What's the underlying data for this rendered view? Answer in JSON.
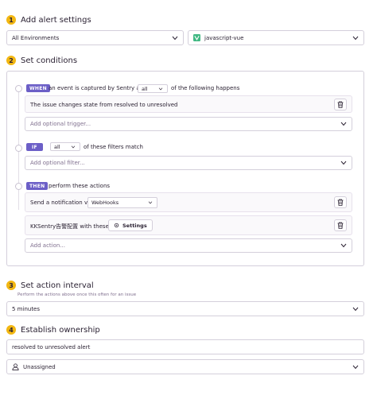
{
  "steps": {
    "s1": {
      "num": "1",
      "title": "Add alert settings"
    },
    "s2": {
      "num": "2",
      "title": "Set conditions"
    },
    "s3": {
      "num": "3",
      "title": "Set action interval",
      "subtitle": "Perform the actions above once this often for an issue"
    },
    "s4": {
      "num": "4",
      "title": "Establish ownership"
    }
  },
  "settings": {
    "environment": "All Environments",
    "project": "javascript-vue"
  },
  "conditions": {
    "when": {
      "badge": "WHEN",
      "text_before": "an event is captured by Sentry and",
      "match": "all",
      "text_after": "of the following happens",
      "trigger": "The issue changes state from resolved to unresolved",
      "add_placeholder": "Add optional trigger..."
    },
    "if": {
      "badge": "IF",
      "match": "all",
      "text_after": "of these filters match",
      "add_placeholder": "Add optional filter..."
    },
    "then": {
      "badge": "THEN",
      "text_after": "perform these actions",
      "action1_label": "Send a notification via",
      "action1_service": "WebHooks",
      "action2_label": "KKSentry告警配置 with these",
      "action2_button": "Settings",
      "add_placeholder": "Add action..."
    }
  },
  "interval": {
    "value": "5 minutes"
  },
  "ownership": {
    "alert_name": "resolved to unresolved alert",
    "owner": "Unassigned"
  },
  "colors": {
    "accent": "#6c5fc7",
    "step": "#f2b712",
    "vue": "#41b883"
  }
}
